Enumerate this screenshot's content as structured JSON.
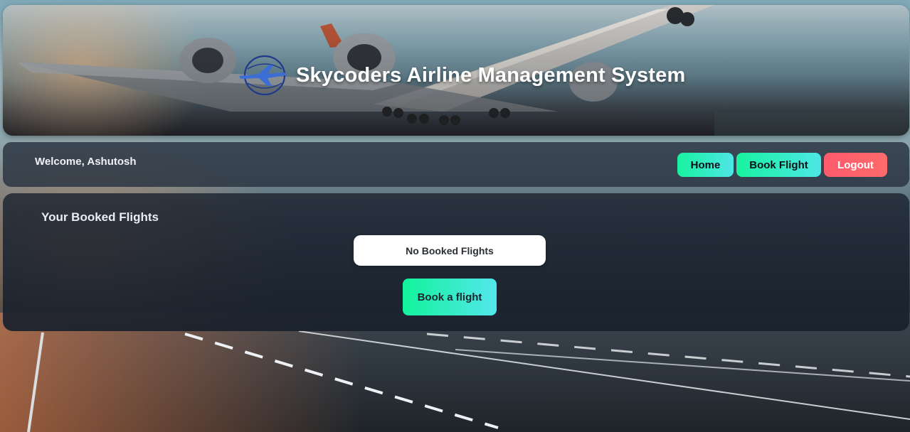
{
  "header": {
    "title": "Skycoders Airline Management System",
    "logo_icon": "airplane-globe-icon"
  },
  "nav": {
    "welcome": "Welcome, Ashutosh",
    "home_label": "Home",
    "book_label": "Book Flight",
    "logout_label": "Logout"
  },
  "bookings": {
    "title": "Your Booked Flights",
    "empty_message": "No Booked Flights",
    "cta_label": "Book a flight"
  },
  "colors": {
    "primary_gradient_start": "#18f2a0",
    "primary_gradient_end": "#4ee6e6",
    "logout": "#ff5a6c",
    "panel": "#202834"
  }
}
